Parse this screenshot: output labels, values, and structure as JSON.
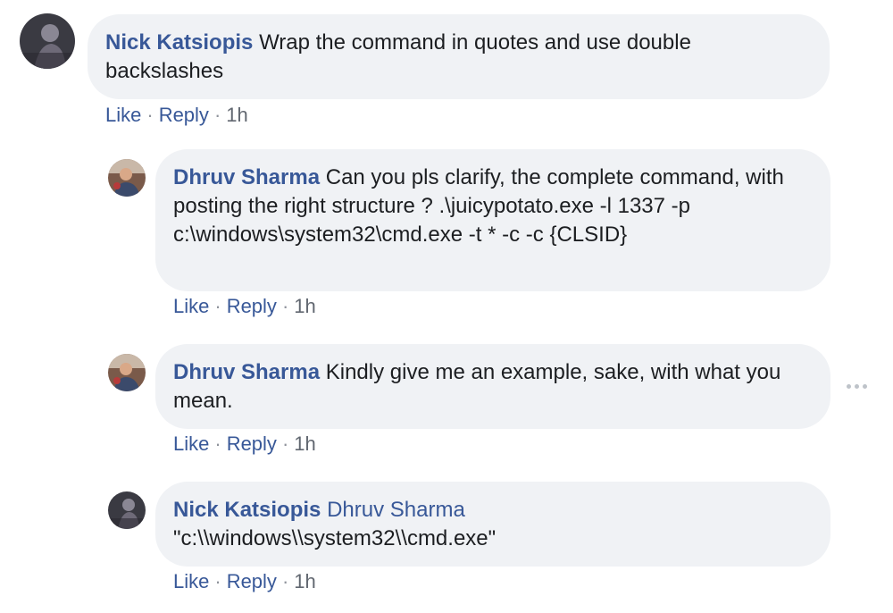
{
  "comments": [
    {
      "author": "Nick Katsiopis",
      "tag": "",
      "text": "Wrap the command in quotes and use double backslashes",
      "like": "Like",
      "reply": "Reply",
      "time": "1h"
    },
    {
      "author": "Dhruv Sharma",
      "tag": "",
      "text": "Can you pls clarify, the complete command, with posting the right structure ? .\\juicypotato.exe -l 1337 -p c:\\windows\\system32\\cmd.exe -t * -c -c {CLSID}",
      "like": "Like",
      "reply": "Reply",
      "time": "1h"
    },
    {
      "author": "Dhruv Sharma",
      "tag": "",
      "text": "Kindly give me an example, sake, with what you mean.",
      "like": "Like",
      "reply": "Reply",
      "time": "1h"
    },
    {
      "author": "Nick Katsiopis",
      "tag": "Dhruv Sharma",
      "text": "\"c:\\\\windows\\\\system32\\\\cmd.exe\"",
      "like": "Like",
      "reply": "Reply",
      "time": "1h"
    }
  ],
  "separator": "·",
  "icons": {
    "more": "more-options-icon",
    "avatar_nick": "avatar-nick-katsiopis",
    "avatar_dhruv": "avatar-dhruv-sharma"
  }
}
